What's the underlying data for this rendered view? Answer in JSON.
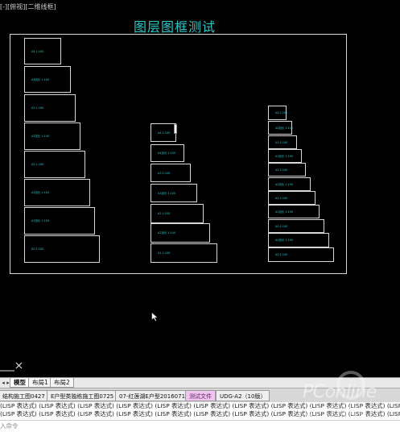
{
  "viewport": {
    "view_label": "[-][俯视][二维线框]",
    "drawing_title": "图层图框测试"
  },
  "sheets": {
    "left": [
      {
        "label": "A4 1:100"
      },
      {
        "label": "A4加长 1:100"
      },
      {
        "label": "A3 1:100"
      },
      {
        "label": "A3加长 1:100"
      },
      {
        "label": "A2 1:100"
      },
      {
        "label": "A2加长 1:100"
      },
      {
        "label": "A1加长 1:100"
      },
      {
        "label": "A0 1:100"
      }
    ],
    "middle": [
      {
        "label": "A4 1:100"
      },
      {
        "label": "A4加长 1:100"
      },
      {
        "label": "A3 1:100"
      },
      {
        "label": "A3加长 1:100"
      },
      {
        "label": "A2 1:100"
      },
      {
        "label": "A2加长 1:100"
      },
      {
        "label": "A1 1:100"
      }
    ],
    "right": [
      {
        "label": "A4 1:100"
      },
      {
        "label": "A4加长 1:100"
      },
      {
        "label": "A3 1:100"
      },
      {
        "label": "A3加长 1:100"
      },
      {
        "label": "A2 1:100"
      },
      {
        "label": "A2加长 1:100"
      },
      {
        "label": "A1 1:100"
      },
      {
        "label": "A1加长 1:100"
      },
      {
        "label": "A0 1:100"
      },
      {
        "label": "A0加长 1:100"
      },
      {
        "label": "A0 1:100"
      }
    ]
  },
  "layout_tabs": {
    "model": "模型",
    "layout1": "布局1",
    "layout2": "布局2"
  },
  "file_tabs": [
    {
      "label": "结构施工图0427",
      "active": false
    },
    {
      "label": "E户型类独栋施工图0725",
      "active": false
    },
    {
      "label": "07-红莲湖E户型20160718",
      "active": false
    },
    {
      "label": "测试文件",
      "active": true
    },
    {
      "label": "UDG-A2（10版）",
      "active": false
    }
  ],
  "command": {
    "history_1": "(LISP 表达式) (LISP 表达式) (LISP 表达式) (LISP 表达式) (LISP 表达式) (LISP 表达式) (LISP 表达式) (LISP 表达式) (LISP 表达式) (LISP 表达式) (LISP 表达式) (LISP 表达式) (LISP",
    "history_2": "(LISP 表达式) (LISP 表达式) (LISP 表达式) (LISP 表达式) (LISP 表达式) (LISP 表达式) (LISP 表达式) (LISP 表达式) (LISP 表达式) (LISP 表达式) (LISP 表达式) (LISP 表达式) (LISP",
    "prompt_placeholder": "入命令"
  },
  "watermark": {
    "brand": "PConline",
    "sub": "太平洋电脑网"
  },
  "colors": {
    "title": "#28c8c8",
    "sheet_border": "#d8d8d8",
    "active_file_tab": "#f0c6f0"
  }
}
